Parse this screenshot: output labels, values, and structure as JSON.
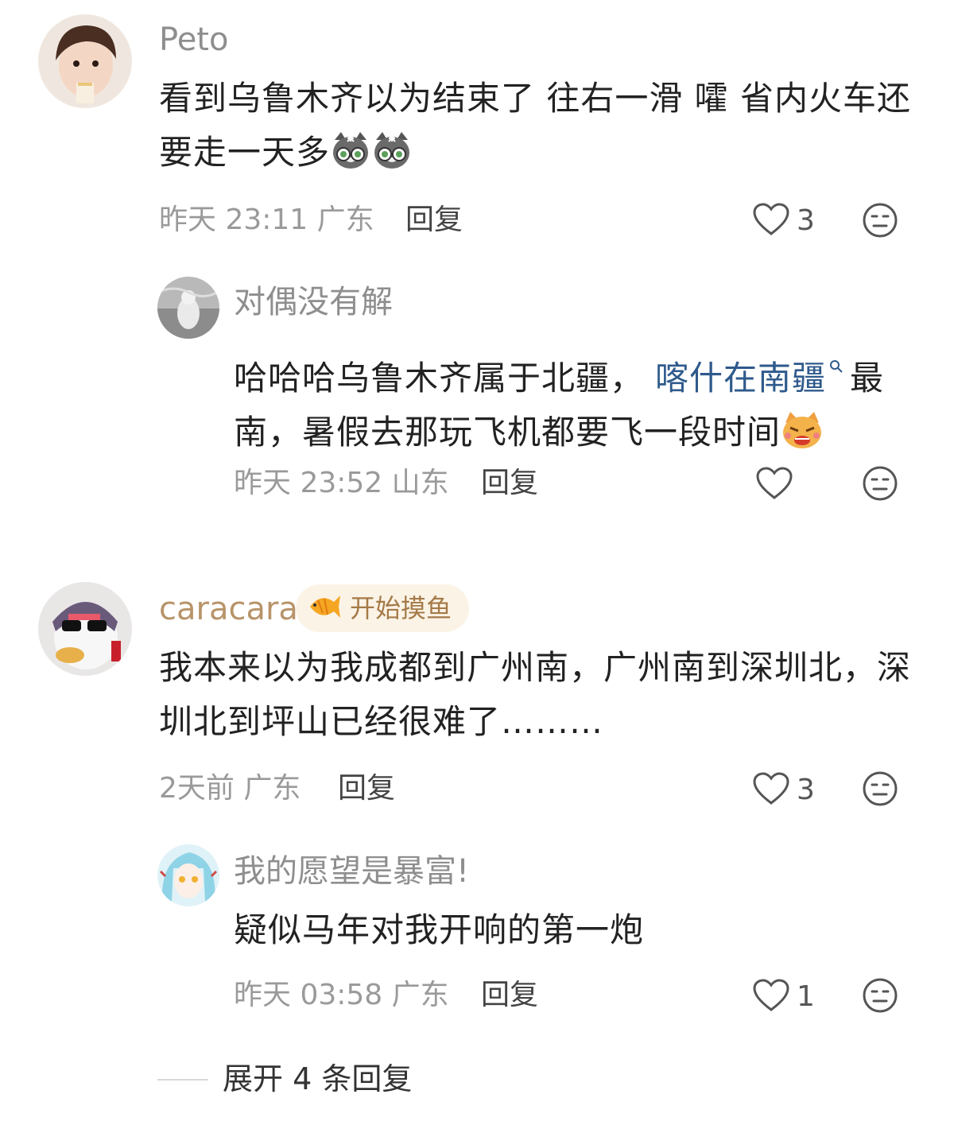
{
  "comments": [
    {
      "author": "Peto",
      "text_part1": "看到乌鲁木齐以为结束了 往右一滑 嚯 省内火车还要走一天多",
      "emoji": [
        "cat-glasses-emoji",
        "cat-glasses-emoji"
      ],
      "time": "昨天 23:11 广东",
      "reply_label": "回复",
      "likes": "3",
      "replies": [
        {
          "author": "对偶没有解",
          "text_before": "哈哈哈乌鲁木齐属于北疆，",
          "link_text": "喀什在南疆",
          "text_after": "最南，暑假去那玩飞机都要飞一段时间",
          "emoji": "angry-cat-emoji",
          "time": "昨天 23:52 山东",
          "reply_label": "回复",
          "likes": ""
        }
      ]
    },
    {
      "author": "caracara",
      "badge": "开始摸鱼",
      "text": "我本来以为我成都到广州南，广州南到深圳北，深圳北到坪山已经很难了………",
      "time": "2天前 广东",
      "reply_label": "回复",
      "likes": "3",
      "replies": [
        {
          "author": "我的愿望是暴富!",
          "text": "疑似马年对我开响的第一炮",
          "time": "昨天 03:58 广东",
          "reply_label": "回复",
          "likes": "1"
        }
      ]
    }
  ],
  "expand_label": "展开 4 条回复",
  "colors": {
    "accent_name": "#b8946a",
    "link": "#2f5a8c",
    "badge_bg": "#fbf3e6",
    "muted": "#9a9a9a"
  }
}
